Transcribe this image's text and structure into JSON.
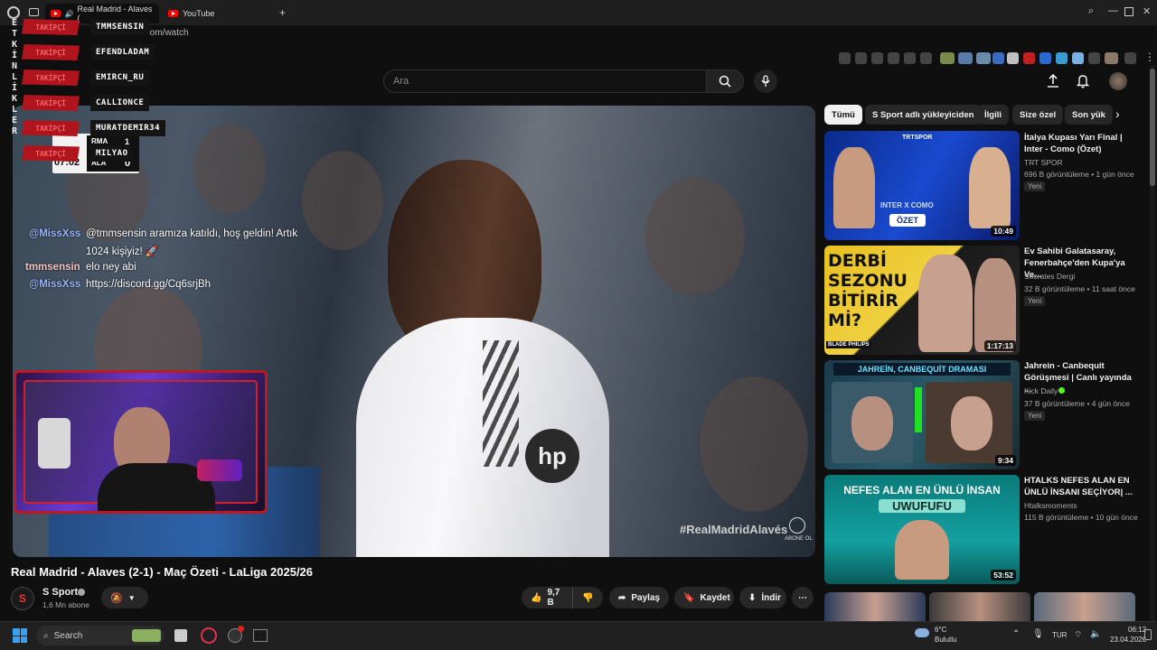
{
  "browser": {
    "tabs": [
      {
        "label": "Real Madrid - Alaves (",
        "active": true
      },
      {
        "label": "YouTube",
        "active": false
      }
    ],
    "new_tab_icon": "plus-icon",
    "url": ".com/watch"
  },
  "youtube": {
    "search_placeholder": "Ara",
    "chips": [
      "Tümü",
      "S Sport adlı yükleyiciden",
      "İlgili",
      "Size özel",
      "Son yük"
    ]
  },
  "overlay": {
    "vertical_text": "ETKİNLİKLER",
    "follow_label": "TAKİPÇİ",
    "followers": [
      "TMMSENSIN",
      "EFENDLADAM",
      "EMIRCN_RU",
      "CALLIONCE",
      "MURATDEMIR34",
      "MILYAO"
    ],
    "score": {
      "time": "07:02",
      "home": "RMA",
      "away": "ALA",
      "home_score": "1",
      "away_score": "0"
    },
    "chat": [
      {
        "user": "@MissXss",
        "text": "@tmmsensin aramıza katıldı, hoş geldin! Artık",
        "text2": "1024 kişiyiz! 🚀"
      },
      {
        "user": "tmmsensin",
        "text": "elo ney abi"
      },
      {
        "user": "@MissXss",
        "text": "https://discord.gg/Cq6srjBh"
      }
    ],
    "watermark": "#RealMadridAlavés",
    "channel_mark": "ABONE OL"
  },
  "video": {
    "title": "Real Madrid - Alaves (2-1) - Maç Özeti - LaLiga 2025/26",
    "channel": "S Sport",
    "subscribers": "1,6 Mn abone",
    "likes": "9,7 B",
    "share_label": "Paylaş",
    "save_label": "Kaydet",
    "download_label": "İndir"
  },
  "recommendations": [
    {
      "title": "İtalya Kupası Yarı Final | Inter - Como (Özet)",
      "channel": "TRT SPOR",
      "meta": "696 B görüntüleme • 1 gün önce",
      "badge": "Yeni",
      "duration": "10:49",
      "thumb_text": "ÖZET",
      "thumb_top": "TRTSPOR",
      "thumb_mid": "INTER X COMO"
    },
    {
      "title": "Ev Sahibi Galatasaray, Fenerbahçe'den Kupa'ya Ve...",
      "channel": "Socrates Dergi",
      "meta": "32 B görüntüleme • 11 saat önce",
      "badge": "Yeni",
      "duration": "1:17:13",
      "thumb_text": "DERBİ SEZONU BİTİRİR Mİ?",
      "thumb_bottom": "BLADE  PHILIPS"
    },
    {
      "title": "Jahrein - Canbequit Görüşmesi | Canlı yayında ...",
      "channel": "Kick Daily",
      "meta": "37 B görüntüleme • 4 gün önce",
      "badge": "Yeni",
      "duration": "9:34",
      "thumb_text": "JAHREİN, CANBEQUİT DRAMASI"
    },
    {
      "title": "HTALKS NEFES ALAN EN ÜNLÜ İNSANI SEÇİYOR| ...",
      "channel": "Htalksmoments",
      "meta": "115 B görüntüleme • 10 gün önce",
      "badge": "",
      "duration": "53:52",
      "thumb_text": "NEFES ALAN EN ÜNLÜ İNSAN",
      "thumb_sub": "UWUFUFU"
    }
  ],
  "taskbar": {
    "search": "Search",
    "weather_temp": "6°C",
    "weather_desc": "Bulutlu",
    "lang": "TUR",
    "time": "06:12",
    "date": "23.04.2026"
  },
  "colors": {
    "accent": "#ff0000",
    "overlay_red": "#b0141c",
    "bg": "#0f0f0f"
  }
}
